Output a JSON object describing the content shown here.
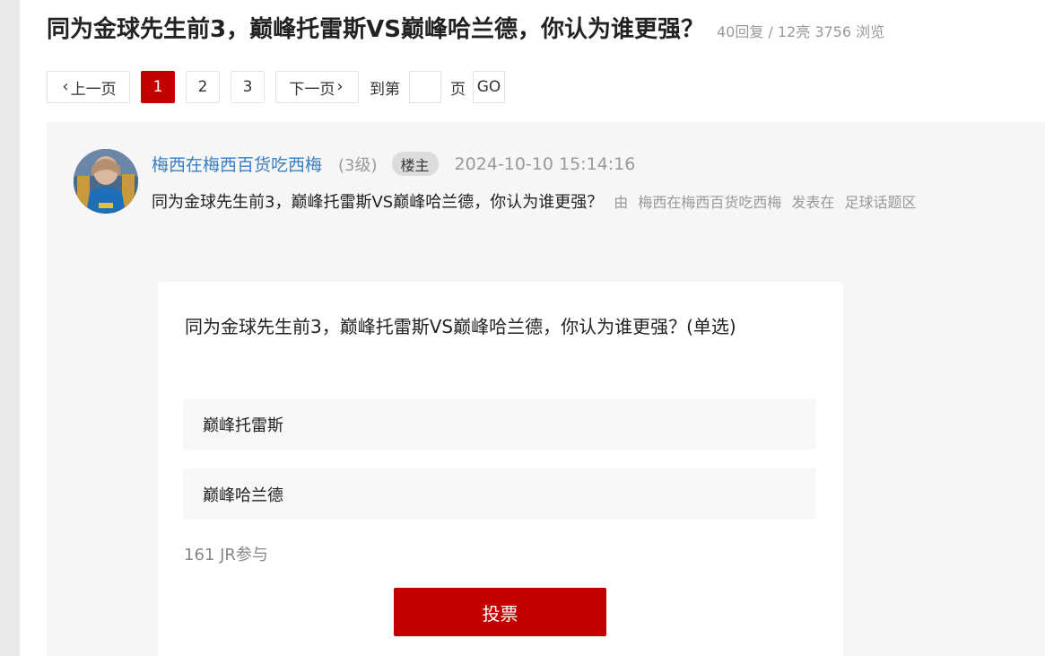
{
  "thread": {
    "title": "同为金球先生前3，巅峰托雷斯VS巅峰哈兰德，你认为谁更强？",
    "stats": "40回复 / 12亮 3756 浏览"
  },
  "pager": {
    "prev_label": "上一页",
    "pages": [
      "1",
      "2",
      "3"
    ],
    "current_page": "1",
    "next_label": "下一页",
    "goto_label": "到第",
    "goto_value": "",
    "page_label": "页",
    "go_label": "GO"
  },
  "post": {
    "author": "梅西在梅西百货吃西梅",
    "level": "(3级)",
    "badge": "楼主",
    "time": "2024-10-10 15:14:16",
    "subtitle": "同为金球先生前3，巅峰托雷斯VS巅峰哈兰德，你认为谁更强？",
    "meta_by": "由",
    "meta_author": "梅西在梅西百货吃西梅",
    "meta_posted_in": "发表在",
    "meta_forum": "足球话题区"
  },
  "poll": {
    "question": "同为金球先生前3，巅峰托雷斯VS巅峰哈兰德，你认为谁更强？(单选)",
    "options": [
      "巅峰托雷斯",
      "巅峰哈兰德"
    ],
    "participants": "161 JR参与",
    "vote_label": "投票"
  },
  "colors": {
    "accent": "#c30000",
    "link": "#3b7ec2",
    "muted": "#999999"
  }
}
